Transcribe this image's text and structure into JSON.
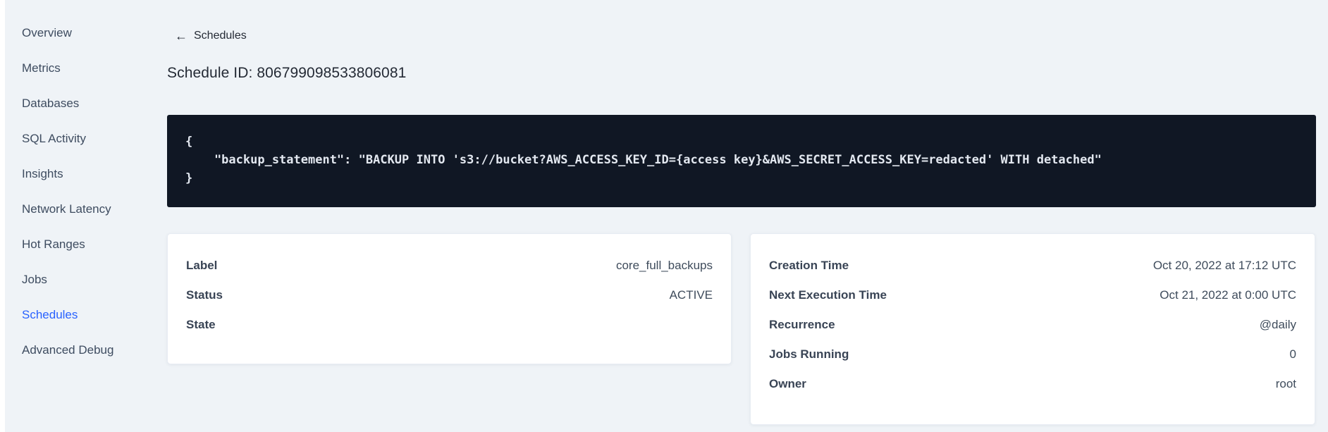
{
  "colors": {
    "page_bg": "#eff3f7",
    "active_link": "#2962ff",
    "heading_text": "#242a35",
    "label_text": "#394455",
    "code_bg": "#101724",
    "code_text": "#e3e8f0",
    "card_bg": "#ffffff"
  },
  "sidebar": {
    "items": [
      {
        "label": "Overview"
      },
      {
        "label": "Metrics"
      },
      {
        "label": "Databases"
      },
      {
        "label": "SQL Activity"
      },
      {
        "label": "Insights"
      },
      {
        "label": "Network Latency"
      },
      {
        "label": "Hot Ranges"
      },
      {
        "label": "Jobs"
      },
      {
        "label": "Schedules"
      },
      {
        "label": "Advanced Debug"
      }
    ],
    "active_item": "Schedules"
  },
  "header": {
    "back_icon": "←",
    "back_label": "Schedules",
    "title": "Schedule ID: 806799098533806081"
  },
  "code_block": {
    "lines": {
      "open": "{",
      "statement": "    \"backup_statement\": \"BACKUP INTO 's3://bucket?AWS_ACCESS_KEY_ID={access key}&AWS_SECRET_ACCESS_KEY=redacted' WITH detached\"",
      "close": "}"
    }
  },
  "details_card": {
    "rows": [
      {
        "label": "Label",
        "value": "core_full_backups"
      },
      {
        "label": "Status",
        "value": "ACTIVE"
      },
      {
        "label": "State",
        "value": ""
      }
    ]
  },
  "schedule_card": {
    "rows": [
      {
        "label": "Creation Time",
        "value": "Oct 20, 2022 at 17:12 UTC"
      },
      {
        "label": "Next Execution Time",
        "value": "Oct 21, 2022 at 0:00 UTC"
      },
      {
        "label": "Recurrence",
        "value": "@daily"
      },
      {
        "label": "Jobs Running",
        "value": "0"
      },
      {
        "label": "Owner",
        "value": "root"
      }
    ]
  }
}
